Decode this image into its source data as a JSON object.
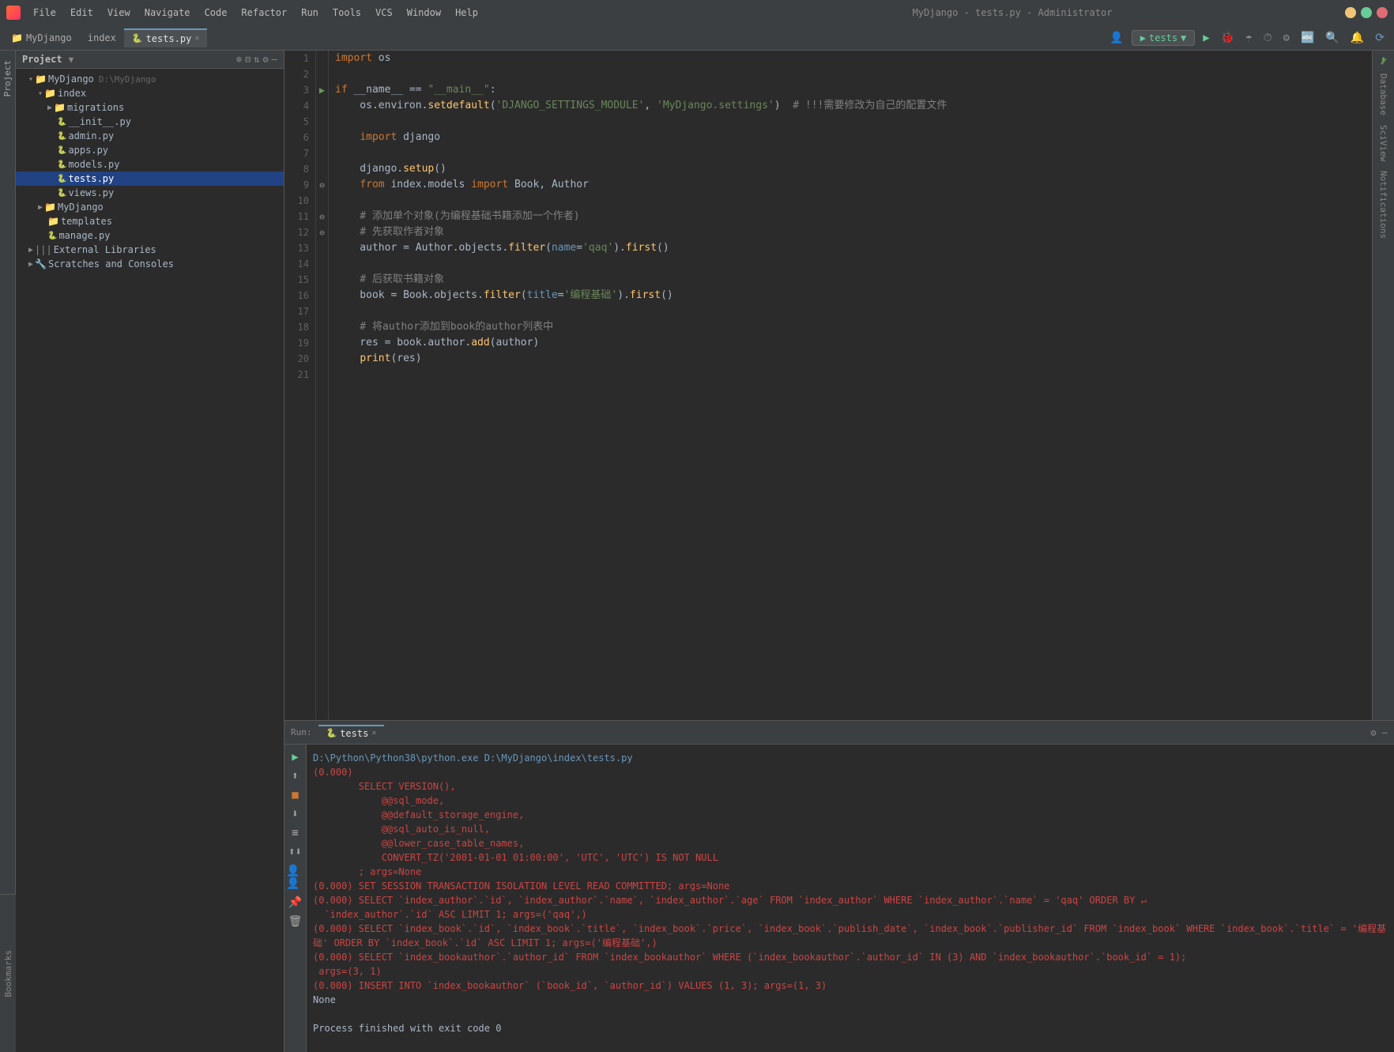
{
  "titlebar": {
    "title": "MyDjango - tests.py - Administrator",
    "menu_items": [
      "File",
      "Edit",
      "View",
      "Navigate",
      "Code",
      "Refactor",
      "Run",
      "Tools",
      "VCS",
      "Window",
      "Help"
    ]
  },
  "tabs": {
    "project_tab": "MyDjango",
    "index_tab": "index",
    "file_tab": "tests.py"
  },
  "toolbar": {
    "run_label": "tests"
  },
  "project_panel": {
    "title": "Project",
    "root": "MyDjango",
    "root_path": "D:\\MyDjango",
    "items": [
      {
        "label": "index",
        "type": "folder",
        "indent": 2
      },
      {
        "label": "migrations",
        "type": "folder",
        "indent": 3
      },
      {
        "label": "__init__.py",
        "type": "py",
        "indent": 4
      },
      {
        "label": "admin.py",
        "type": "py",
        "indent": 4
      },
      {
        "label": "apps.py",
        "type": "py",
        "indent": 4
      },
      {
        "label": "models.py",
        "type": "py",
        "indent": 4
      },
      {
        "label": "tests.py",
        "type": "py",
        "indent": 4,
        "selected": true
      },
      {
        "label": "views.py",
        "type": "py",
        "indent": 4
      },
      {
        "label": "MyDjango",
        "type": "folder",
        "indent": 2
      },
      {
        "label": "templates",
        "type": "folder",
        "indent": 3
      },
      {
        "label": "manage.py",
        "type": "py",
        "indent": 3
      },
      {
        "label": "External Libraries",
        "type": "lib",
        "indent": 1
      },
      {
        "label": "Scratches and Consoles",
        "type": "scratches",
        "indent": 1
      }
    ]
  },
  "editor": {
    "filename": "tests.py",
    "lines": [
      {
        "num": 1,
        "code": "import os"
      },
      {
        "num": 2,
        "code": ""
      },
      {
        "num": 3,
        "code": "if __name__ == \"__main__\":"
      },
      {
        "num": 4,
        "code": "    os.environ.setdefault('DJANGO_SETTINGS_MODULE', 'MyDjango.settings')  # !!!需要修改为自己的配置文件"
      },
      {
        "num": 5,
        "code": ""
      },
      {
        "num": 6,
        "code": "    import django"
      },
      {
        "num": 7,
        "code": ""
      },
      {
        "num": 8,
        "code": "    django.setup()"
      },
      {
        "num": 9,
        "code": "    from index.models import Book, Author"
      },
      {
        "num": 10,
        "code": ""
      },
      {
        "num": 11,
        "code": "    # 添加单个对象(为编程基础书籍添加一个作者)"
      },
      {
        "num": 12,
        "code": "    # 先获取作者对象"
      },
      {
        "num": 13,
        "code": "    author = Author.objects.filter(name='qaq').first()"
      },
      {
        "num": 14,
        "code": ""
      },
      {
        "num": 15,
        "code": "    # 后获取书籍对象"
      },
      {
        "num": 16,
        "code": "    book = Book.objects.filter(title='编程基础').first()"
      },
      {
        "num": 17,
        "code": ""
      },
      {
        "num": 18,
        "code": "    # 将author添加到book的author列表中"
      },
      {
        "num": 19,
        "code": "    res = book.author.add(author)"
      },
      {
        "num": 20,
        "code": "    print(res)"
      },
      {
        "num": 21,
        "code": ""
      }
    ]
  },
  "run_panel": {
    "tab_label": "tests",
    "command": "D:\\Python\\Python38\\python.exe D:\\MyDjango\\index\\tests.py",
    "output_lines": [
      "(0.000)",
      "        SELECT VERSION(),",
      "            @@sql_mode,",
      "            @@default_storage_engine,",
      "            @@sql_auto_is_null,",
      "            @@lower_case_table_names,",
      "            CONVERT_TZ('2001-01-01 01:00:00', 'UTC', 'UTC') IS NOT NULL",
      "        ; args=None",
      "(0.000) SET SESSION TRANSACTION ISOLATION LEVEL READ COMMITTED; args=None",
      "(0.000) SELECT `index_author`.`id`, `index_author`.`name`, `index_author`.`age` FROM `index_author` WHERE `index_author`.`name` = 'qaq' ORDER BY `index_author`.`id` ASC LIMIT 1; args=('qaq',)",
      "(0.000) SELECT `index_book`.`id`, `index_book`.`title`, `index_book`.`price`, `index_book`.`publish_date`, `index_book`.`publisher_id` FROM `index_book` WHERE `index_book`.`title` = '编程基础' ORDER BY `index_book`.`id` ASC LIMIT 1; args=('编程基础',)",
      "(0.000) SELECT `index_bookauthor`.`author_id` FROM `index_bookauthor` WHERE (`index_bookauthor`.`author_id` IN (3) AND `index_bookauthor`.`book_id` = 1); args=(3, 1)",
      "(0.000) INSERT INTO `index_bookauthor` (`book_id`, `author_id`) VALUES (1, 3); args=(1, 3)",
      "None",
      "",
      "Process finished with exit code 0"
    ]
  },
  "right_sidebar": {
    "labels": [
      "Database",
      "SciView",
      "Notifications"
    ]
  },
  "bookmarks_label": "Bookmarks"
}
